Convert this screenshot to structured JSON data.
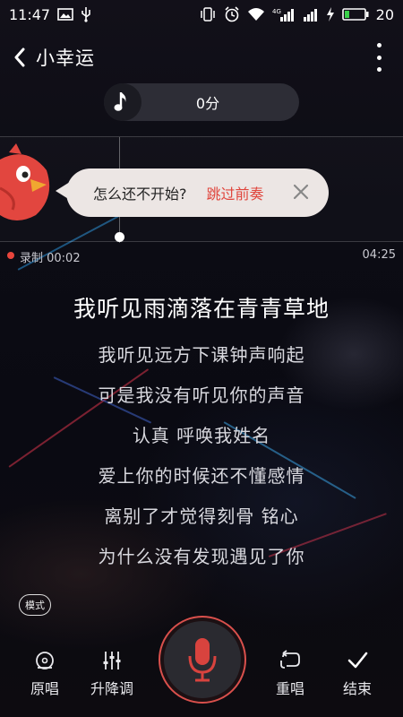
{
  "statusbar": {
    "time": "11:47",
    "battery": "20",
    "network": "4G"
  },
  "header": {
    "title": "小幸运"
  },
  "score": {
    "value": "0分"
  },
  "prompt": {
    "question": "怎么还不开始?",
    "skip_label": "跳过前奏"
  },
  "recording": {
    "label": "录制 00:02",
    "duration": "04:25"
  },
  "lyrics": {
    "current": "我听见雨滴落在青青草地",
    "lines": [
      "我听见远方下课钟声响起",
      "可是我没有听见你的声音",
      "认真 呼唤我姓名",
      "爱上你的时候还不懂感情",
      "离别了才觉得刻骨 铭心",
      "为什么没有发现遇见了你"
    ]
  },
  "mode": {
    "label": "模式"
  },
  "toolbar": {
    "original": "原唱",
    "pitch": "升降调",
    "restart": "重唱",
    "finish": "结束"
  },
  "colors": {
    "accent_red": "#e0453c",
    "mic_ring": "#d9504c",
    "bubble_bg": "#ece6e4"
  },
  "icons": [
    "back-arrow-icon",
    "more-icon",
    "music-note-icon",
    "close-icon",
    "original-vocal-icon",
    "pitch-sliders-icon",
    "microphone-icon",
    "repeat-icon",
    "checkmark-icon",
    "bird-mascot-icon"
  ]
}
